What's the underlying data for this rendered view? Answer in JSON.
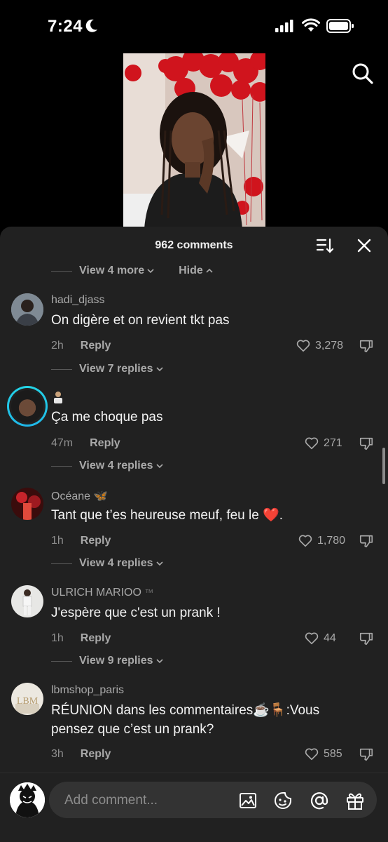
{
  "status_bar": {
    "time": "7:24"
  },
  "sheet": {
    "title": "962 comments",
    "top_controls": {
      "view_more": "View 4 more",
      "hide": "Hide"
    }
  },
  "comments": [
    {
      "username": "hadi_djass",
      "badge": "",
      "text": "On digère et on revient tkt pas",
      "time": "2h",
      "reply": "Reply",
      "likes": "3,278",
      "view_replies": "View 7 replies"
    },
    {
      "username": "",
      "badge": "",
      "text": "Ça me choque pas",
      "time": "47m",
      "reply": "Reply",
      "likes": "271",
      "view_replies": "View 4 replies"
    },
    {
      "username": "Océane",
      "badge": "🦋",
      "text": "Tant que t’es heureuse meuf, feu le",
      "text_emoji": "❤️",
      "time": "1h",
      "reply": "Reply",
      "likes": "1,780",
      "view_replies": "View 4 replies"
    },
    {
      "username": "ULRICH MARIOO",
      "badge": "™",
      "text": "J'espère que c'est un prank !",
      "time": "1h",
      "reply": "Reply",
      "likes": "44",
      "view_replies": "View 9 replies"
    },
    {
      "username": "lbmshop_paris",
      "badge": "",
      "text_line1": "RÉUNION dans les commentaires☕🪑:Vous",
      "text_line2": "pensez que c’est un prank?",
      "time": "3h",
      "reply": "Reply",
      "likes": "585"
    }
  ],
  "composer": {
    "placeholder": "Add comment..."
  },
  "colors": {
    "sheet_bg": "#212121",
    "story_ring": "#24d6e6",
    "heart_red": "#e2262f"
  }
}
